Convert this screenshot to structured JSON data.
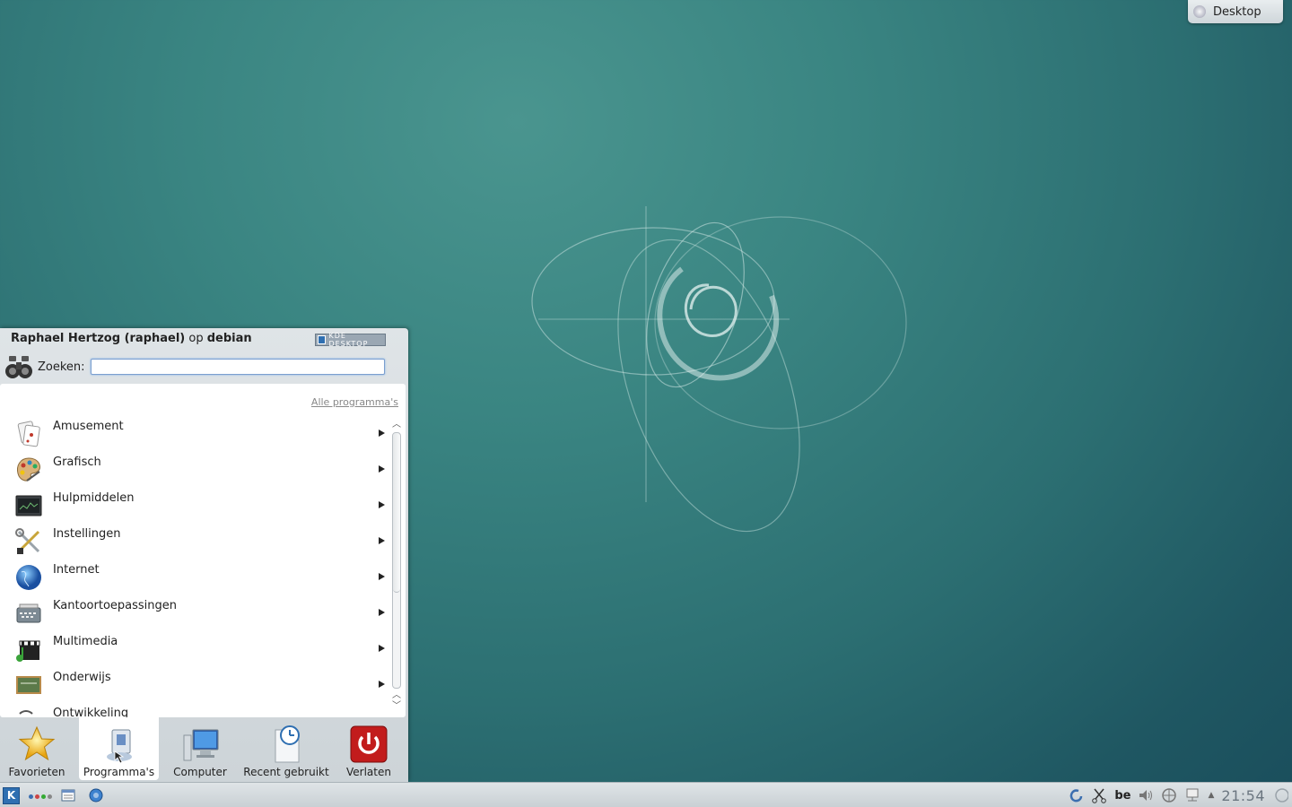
{
  "desktop_toolbox": {
    "label": "Desktop"
  },
  "kickoff": {
    "header": {
      "user": "Raphael Hertzog (raphael)",
      "op": "op",
      "host": "debian"
    },
    "logo_text": "KDE DESKTOP",
    "search": {
      "label": "Zoeken:",
      "value": "",
      "placeholder": ""
    },
    "breadcrumb": "Alle programma's",
    "items": [
      {
        "label": "Amusement",
        "icon": "cards-icon"
      },
      {
        "label": "Grafisch",
        "icon": "palette-icon"
      },
      {
        "label": "Hulpmiddelen",
        "icon": "terminal-icon"
      },
      {
        "label": "Instellingen",
        "icon": "tools-icon"
      },
      {
        "label": "Internet",
        "icon": "globe-icon"
      },
      {
        "label": "Kantoortoepassingen",
        "icon": "typewriter-icon"
      },
      {
        "label": "Multimedia",
        "icon": "clapper-icon"
      },
      {
        "label": "Onderwijs",
        "icon": "chalkboard-icon"
      },
      {
        "label": "Ontwikkeling",
        "icon": "dev-icon"
      }
    ],
    "tabs": [
      {
        "label": "Favorieten",
        "icon": "star-icon"
      },
      {
        "label": "Programma's",
        "icon": "applications-icon"
      },
      {
        "label": "Computer",
        "icon": "computer-icon"
      },
      {
        "label": "Recent gebruikt",
        "icon": "recent-icon"
      },
      {
        "label": "Verlaten",
        "icon": "power-icon"
      }
    ]
  },
  "panel": {
    "launcher_label": "K",
    "keyboard_layout": "be",
    "clock": "21:54"
  }
}
